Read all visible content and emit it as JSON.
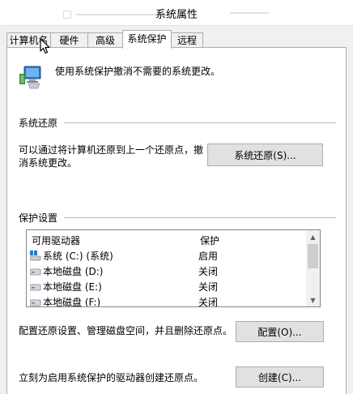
{
  "window": {
    "title": "系统属性"
  },
  "tabs": [
    {
      "label": "计算机名"
    },
    {
      "label": "硬件"
    },
    {
      "label": "高级"
    },
    {
      "label": "系统保护"
    },
    {
      "label": "远程"
    }
  ],
  "intro": {
    "text": "使用系统保护撤消不需要的系统更改。"
  },
  "restore": {
    "heading": "系统还原",
    "description": "可以通过将计算机还原到上一个还原点，撤消系统更改。",
    "button": "系统还原(S)..."
  },
  "protection": {
    "heading": "保护设置",
    "columns": [
      "可用驱动器",
      "保护"
    ],
    "drives": [
      {
        "name": "系统 (C:) (系统)",
        "status": "启用",
        "icon": "system-drive-icon"
      },
      {
        "name": "本地磁盘 (D:)",
        "status": "关闭",
        "icon": "hard-drive-icon"
      },
      {
        "name": "本地磁盘 (E:)",
        "status": "关闭",
        "icon": "hard-drive-icon"
      },
      {
        "name": "本地磁盘 (F:)",
        "status": "关闭",
        "icon": "hard-drive-icon"
      }
    ]
  },
  "configure": {
    "text": "配置还原设置、管理磁盘空间，并且删除还原点。",
    "button": "配置(O)..."
  },
  "create": {
    "text": "立刻为启用系统保护的驱动器创建还原点。",
    "button": "创建(C)..."
  },
  "colors": {
    "panel": "#ffffff",
    "window": "#f0f0f0",
    "border": "#adadad",
    "button": "#e1e1e1"
  }
}
